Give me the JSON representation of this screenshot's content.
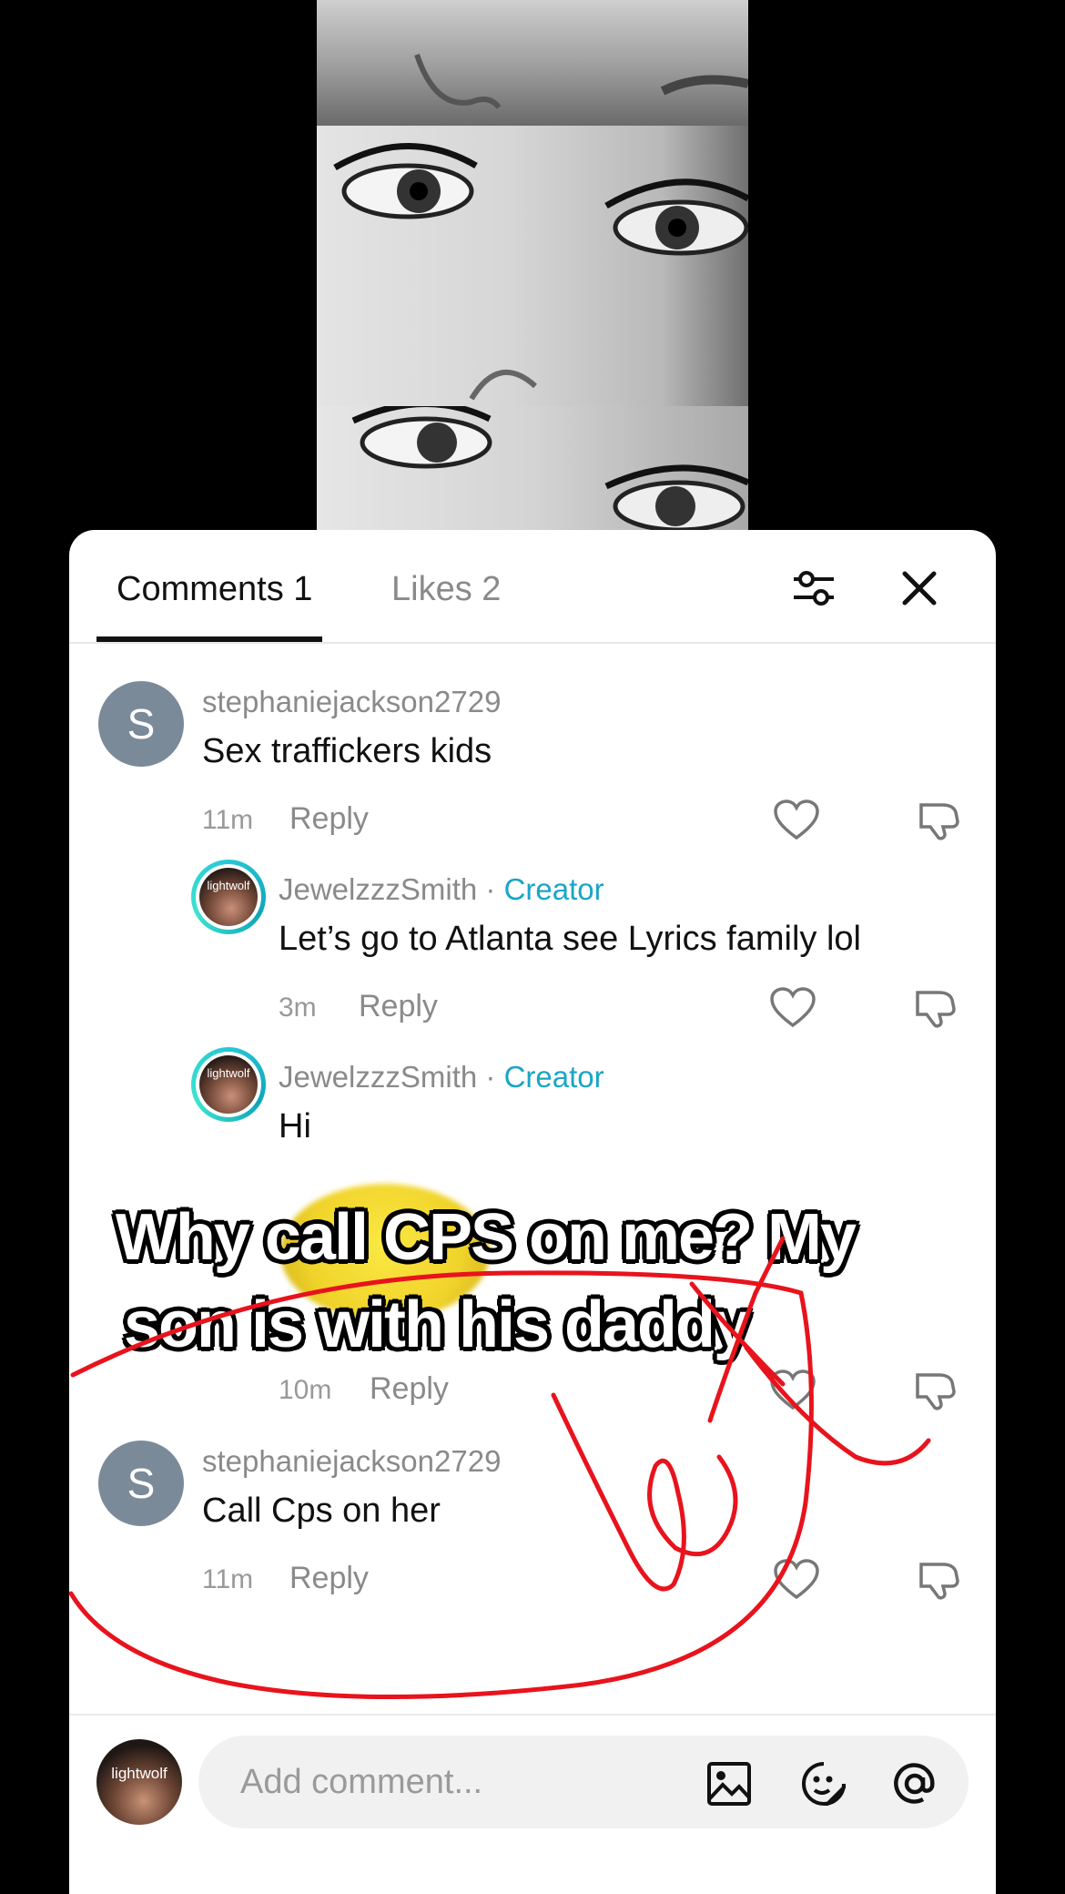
{
  "tabs": {
    "comments": "Comments 1",
    "likes": "Likes 2"
  },
  "comments": [
    {
      "avatar_letter": "S",
      "username": "stephaniejackson2729",
      "text": "Sex traffickers kids",
      "time": "11m",
      "reply": "Reply"
    },
    {
      "username": "JewelzzzSmith",
      "sep": " · ",
      "badge": "Creator",
      "text": "Let’s go to Atlanta see Lyrics family lol",
      "time": "3m",
      "reply": "Reply"
    },
    {
      "username": "JewelzzzSmith",
      "sep": " · ",
      "badge": "Creator",
      "text": "Hi",
      "time": "10m",
      "reply": "Reply"
    },
    {
      "avatar_letter": "S",
      "username": "stephaniejackson2729",
      "text": "Call Cps on her",
      "time": "11m",
      "reply": "Reply"
    }
  ],
  "avatar_caption": "lightwolf",
  "overlay": {
    "line1": "Why call CPS on me? My",
    "line2": "son is with his daddy"
  },
  "input": {
    "placeholder": "Add comment..."
  },
  "icons": [
    "filter-icon",
    "close-icon",
    "heart-icon",
    "dislike-icon",
    "image-icon",
    "emoji-icon",
    "mention-icon"
  ],
  "colors": {
    "creator": "#1aa6c4",
    "scribble": "#e8131c",
    "avatar_bg": "#7a8a99"
  }
}
